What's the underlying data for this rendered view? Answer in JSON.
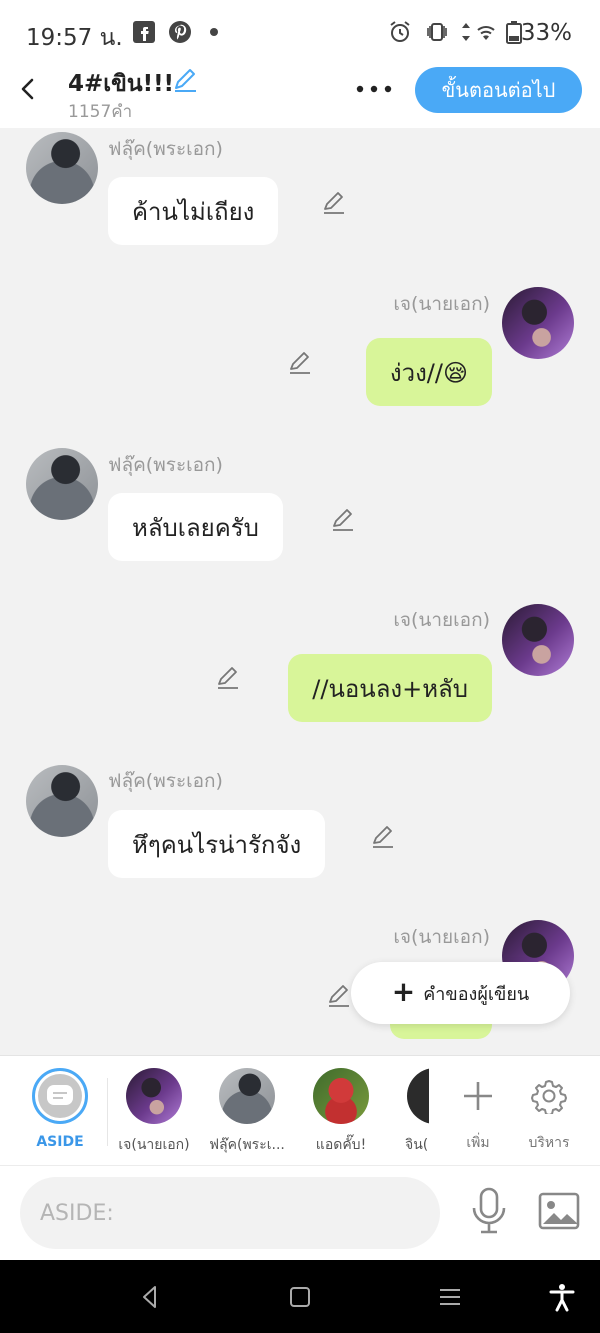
{
  "status": {
    "time": "19:57 น.",
    "battery": "33%"
  },
  "header": {
    "title": "4#เขิน!!!",
    "word_count": "1157คำ",
    "next_label": "ขั้นตอนต่อไป"
  },
  "messages": [
    {
      "side": "left",
      "speaker": "ฟลุ๊ค(พระเอก)",
      "text": "ค้านไม่เถียง"
    },
    {
      "side": "right",
      "speaker": "เจ(นายเอก)",
      "text": "ง่วง//😪"
    },
    {
      "side": "left",
      "speaker": "ฟลุ๊ค(พระเอก)",
      "text": "หลับเลยครับ"
    },
    {
      "side": "right",
      "speaker": "เจ(นายเอก)",
      "text": "//นอนลง+หลับ"
    },
    {
      "side": "left",
      "speaker": "ฟลุ๊ค(พระเอก)",
      "text": "หึๆคนไรน่ารักจัง"
    },
    {
      "side": "right",
      "speaker": "เจ(นายเอก)",
      "text": ""
    }
  ],
  "fab": {
    "label": "คำของผู้เขียน"
  },
  "characters": [
    {
      "label": "ASIDE"
    },
    {
      "label": "เจ(นายเอก)"
    },
    {
      "label": "ฟลุ๊ค(พระเ..."
    },
    {
      "label": "แอดคั๊บ!"
    },
    {
      "label": "จิน("
    }
  ],
  "tools": {
    "add_label": "เพิ่ม",
    "manage_label": "บริหาร"
  },
  "composer": {
    "placeholder": "ASIDE:"
  },
  "colors": {
    "accent": "#4aa9f6",
    "right_bubble": "#d8f599",
    "left_bubble": "#ffffff",
    "background": "#f2f2f2"
  }
}
